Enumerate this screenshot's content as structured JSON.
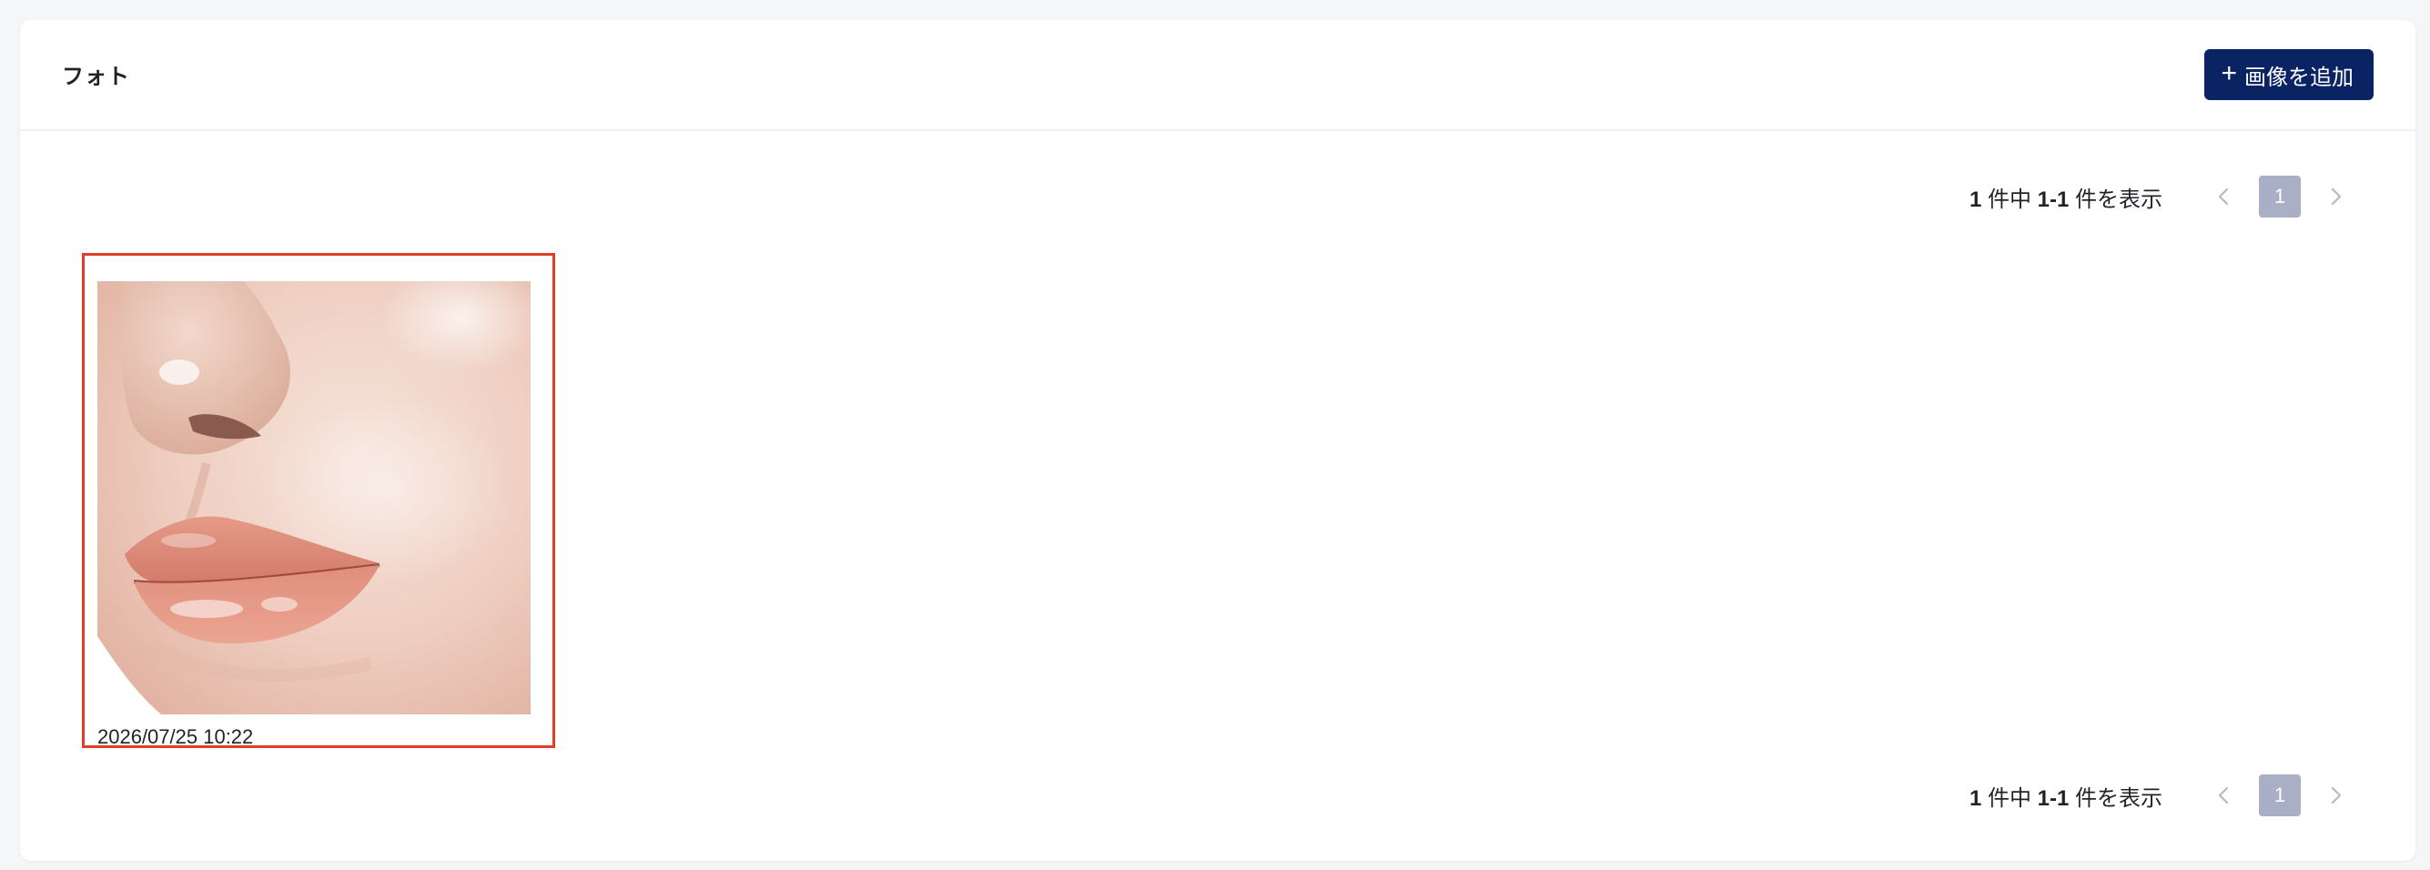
{
  "header": {
    "title": "フォト",
    "add_button_label": "画像を追加",
    "add_button_icon": "plus-icon"
  },
  "pagination_top": {
    "total": "1",
    "total_suffix": " 件中 ",
    "range": "1-1",
    "range_suffix": " 件を表示",
    "current_page": "1"
  },
  "pagination_bottom": {
    "total": "1",
    "total_suffix": " 件中 ",
    "range": "1-1",
    "range_suffix": " 件を表示",
    "current_page": "1"
  },
  "photos": [
    {
      "date": "2026/07/25 10:22",
      "subject": "close-up of nose and lips"
    }
  ],
  "colors": {
    "primary": "#0a2463",
    "selected_border": "#e53c25",
    "page_active_bg": "#a9b0c5"
  }
}
